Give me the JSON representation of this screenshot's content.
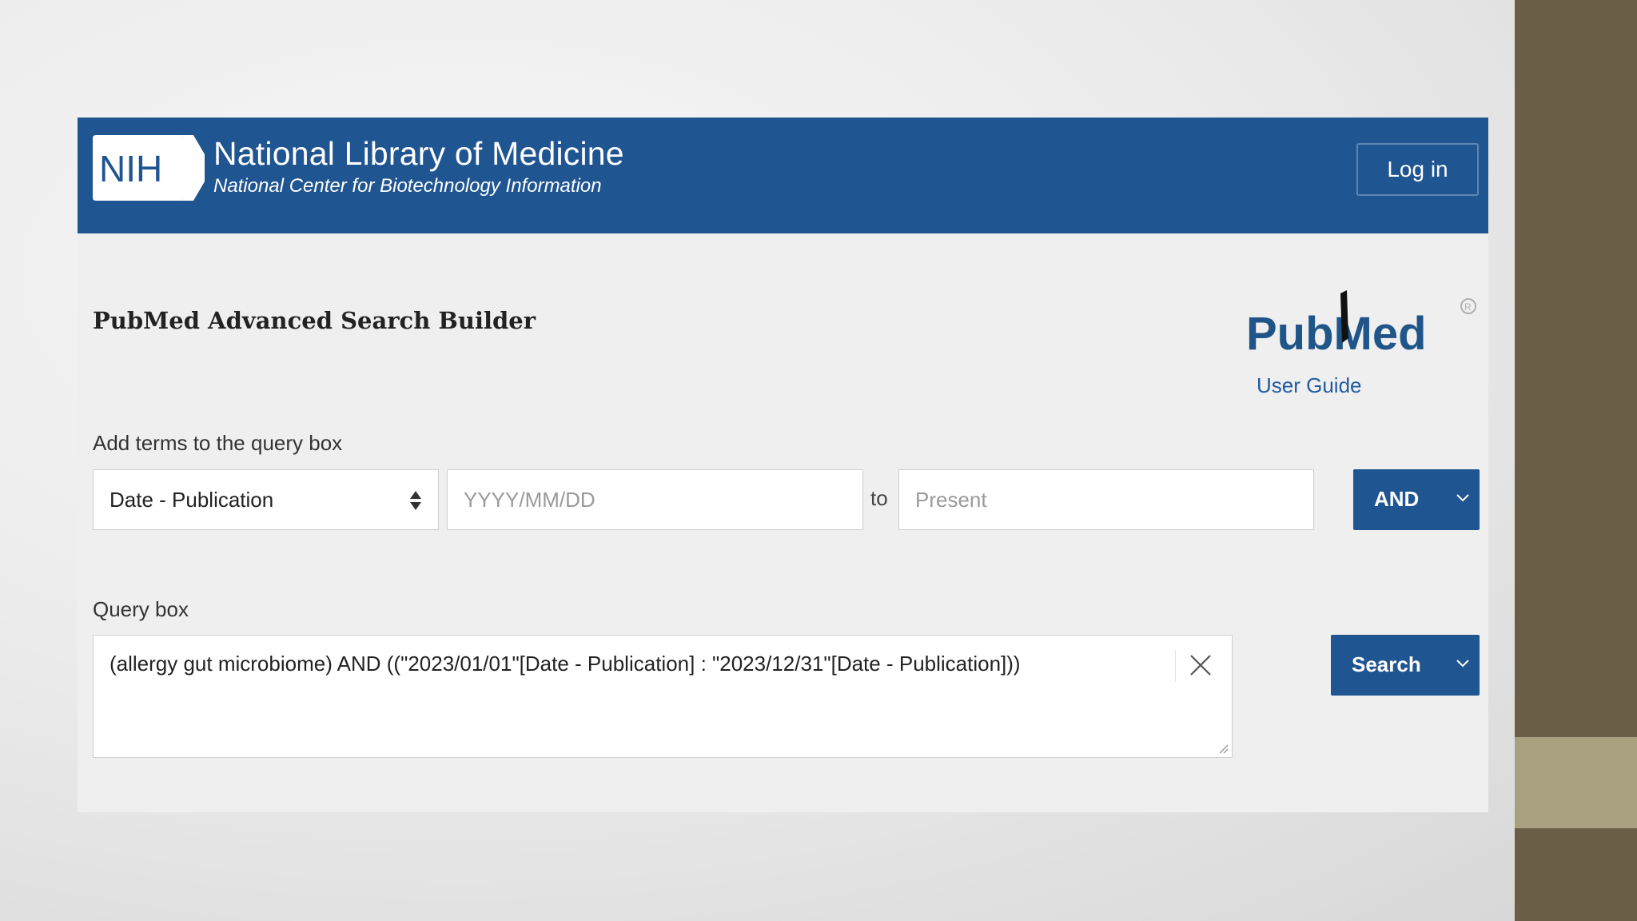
{
  "header": {
    "logo_text": "NIH",
    "title": "National Library of Medicine",
    "subtitle": "National Center for Biotechnology Information",
    "login_label": "Log in"
  },
  "page": {
    "title": "PubMed Advanced Search Builder",
    "logo_text": "PubMed",
    "user_guide_label": "User Guide"
  },
  "builder": {
    "label": "Add terms to the query box",
    "field_selected": "Date - Publication",
    "from_placeholder": "YYYY/MM/DD",
    "to_label": "to",
    "to_placeholder": "Present",
    "operator_label": "AND"
  },
  "query": {
    "label": "Query box",
    "value": "(allergy gut microbiome) AND ((\"2023/01/01\"[Date - Publication] : \"2023/12/31\"[Date - Publication]))",
    "search_label": "Search"
  },
  "colors": {
    "header_bg": "#1f5591",
    "button_bg": "#1f5591",
    "link": "#1f5b9e",
    "side_bar": "#6a5e47",
    "side_bar_accent": "#a8a07e"
  },
  "icons": [
    "select-arrows-icon",
    "chevron-down-icon",
    "close-icon",
    "resize-handle-icon"
  ]
}
